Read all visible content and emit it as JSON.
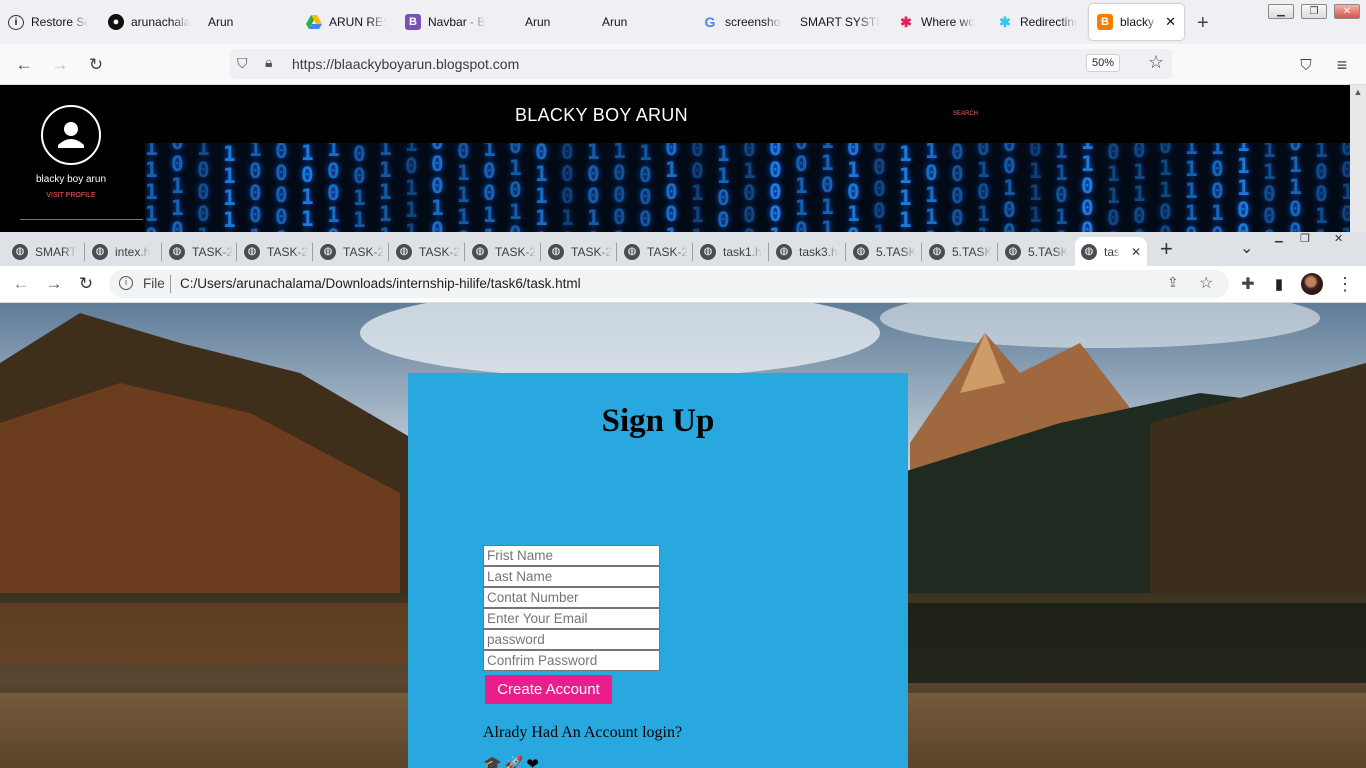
{
  "firefox": {
    "tabs": [
      {
        "label": "Restore Se",
        "icon": "info-icon"
      },
      {
        "label": "arunachala",
        "icon": "github-icon"
      },
      {
        "label": "Arun",
        "icon": "blank-icon"
      },
      {
        "label": "ARUN RES",
        "icon": "google-drive-icon"
      },
      {
        "label": "Navbar · B",
        "icon": "bootstrap-icon"
      },
      {
        "label": "Arun",
        "icon": "blank-icon"
      },
      {
        "label": "Arun",
        "icon": "blank-icon"
      },
      {
        "label": "screenshot",
        "icon": "google-icon"
      },
      {
        "label": "SMART SYSTE",
        "icon": "blank-icon"
      },
      {
        "label": "Where wo",
        "icon": "slack-icon"
      },
      {
        "label": "Redirecting",
        "icon": "slack-icon"
      },
      {
        "label": "blacky b",
        "icon": "blogger-icon"
      }
    ],
    "url": "https://blaackyboyarun.blogspot.com",
    "zoom": "50%"
  },
  "blog": {
    "title": "BLACKY BOY ARUN",
    "search": "SEARCH",
    "profile_name": "blacky boy arun",
    "visit_profile": "VISIT PROFILE"
  },
  "chrome": {
    "tabs": [
      "SMART",
      "intex.h",
      "TASK-2",
      "TASK-2",
      "TASK-2",
      "TASK-2",
      "TASK-2",
      "TASK-2",
      "TASK-2",
      "task1.h",
      "task3.h",
      "5.TASK",
      "5.TASK",
      "5.TASK",
      "tas"
    ],
    "url_prefix": "File",
    "url": "C:/Users/arunachalama/Downloads/internship-hilife/task6/task.html"
  },
  "form": {
    "title": "Sign Up",
    "fields": {
      "first_name": "Frist Name",
      "last_name": "Last Name",
      "contact": "Contat Number",
      "email": "Enter Your Email",
      "password": "password",
      "confirm": "Confrim Password"
    },
    "button": "Create Account",
    "login_text": "Alrady Had An Account login?",
    "social_icons": "🎓🚀❤"
  },
  "colors": {
    "form_bg": "#29a8e0",
    "button_bg": "#e91e8c",
    "blog_bg": "#000000",
    "matrix_digits": "#1b7fe0"
  }
}
